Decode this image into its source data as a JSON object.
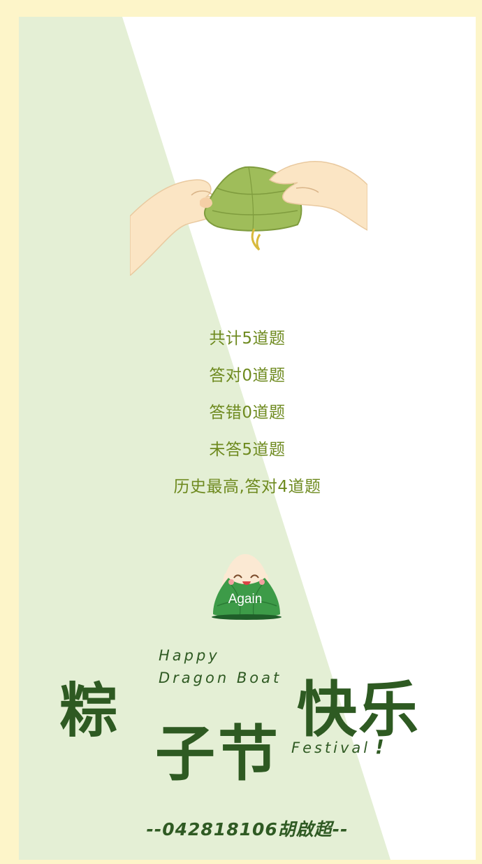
{
  "colors": {
    "page_background": "#fdf5c9",
    "card_background": "#ffffff",
    "diagonal_panel": "#e4efd5",
    "stat_text": "#6e8a1f",
    "dark_green": "#2e5a22",
    "zongzi_green": "#3d9b48"
  },
  "illustration": {
    "icon": "hands-wrapping-zongzi-icon"
  },
  "stats": {
    "total": "共计5道题",
    "correct": "答对0道题",
    "wrong": "答错0道题",
    "unanswered": "未答5道题",
    "best": "历史最高,答对4道题"
  },
  "again_button": {
    "label": "Again",
    "icon": "zongzi-mascot-icon"
  },
  "title_art": {
    "happy": "Happy",
    "dragon_boat": "Dragon Boat",
    "zong": "粽",
    "zijie": "子节",
    "kuaile": "快乐",
    "festival": "Festival",
    "exclaim": "!"
  },
  "author": {
    "text": "--042818106胡啟超--"
  }
}
